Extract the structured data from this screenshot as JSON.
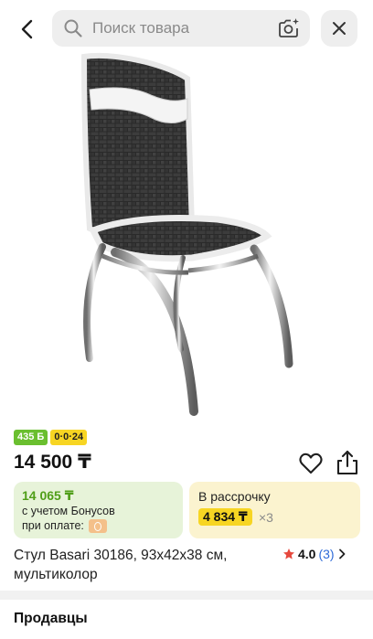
{
  "search": {
    "placeholder": "Поиск товара"
  },
  "badges": {
    "bonus": "435 Б",
    "installment": "0·0·24"
  },
  "price": "14 500 ₸",
  "bonus_card": {
    "price": "14 065 ₸",
    "note_line1": "с учетом Бонусов",
    "note_line2": "при оплате:"
  },
  "installment_card": {
    "title": "В рассрочку",
    "amount": "4 834 ₸",
    "multiplier": "×3"
  },
  "product": {
    "title": "Стул Basari 30186, 93х42х38 см, мультиколор"
  },
  "rating": {
    "value": "4.0",
    "count": "(3)"
  },
  "sellers": {
    "heading": "Продавцы"
  },
  "colors": {
    "bonus_green": "#6abf2f",
    "installment_yellow": "#f7d523",
    "star": "#e6483d",
    "link_blue": "#2f6bd8"
  },
  "icons": [
    "back-arrow-icon",
    "search-icon",
    "camera-icon",
    "close-icon",
    "heart-icon",
    "share-icon",
    "star-icon",
    "chevron-right-icon"
  ]
}
